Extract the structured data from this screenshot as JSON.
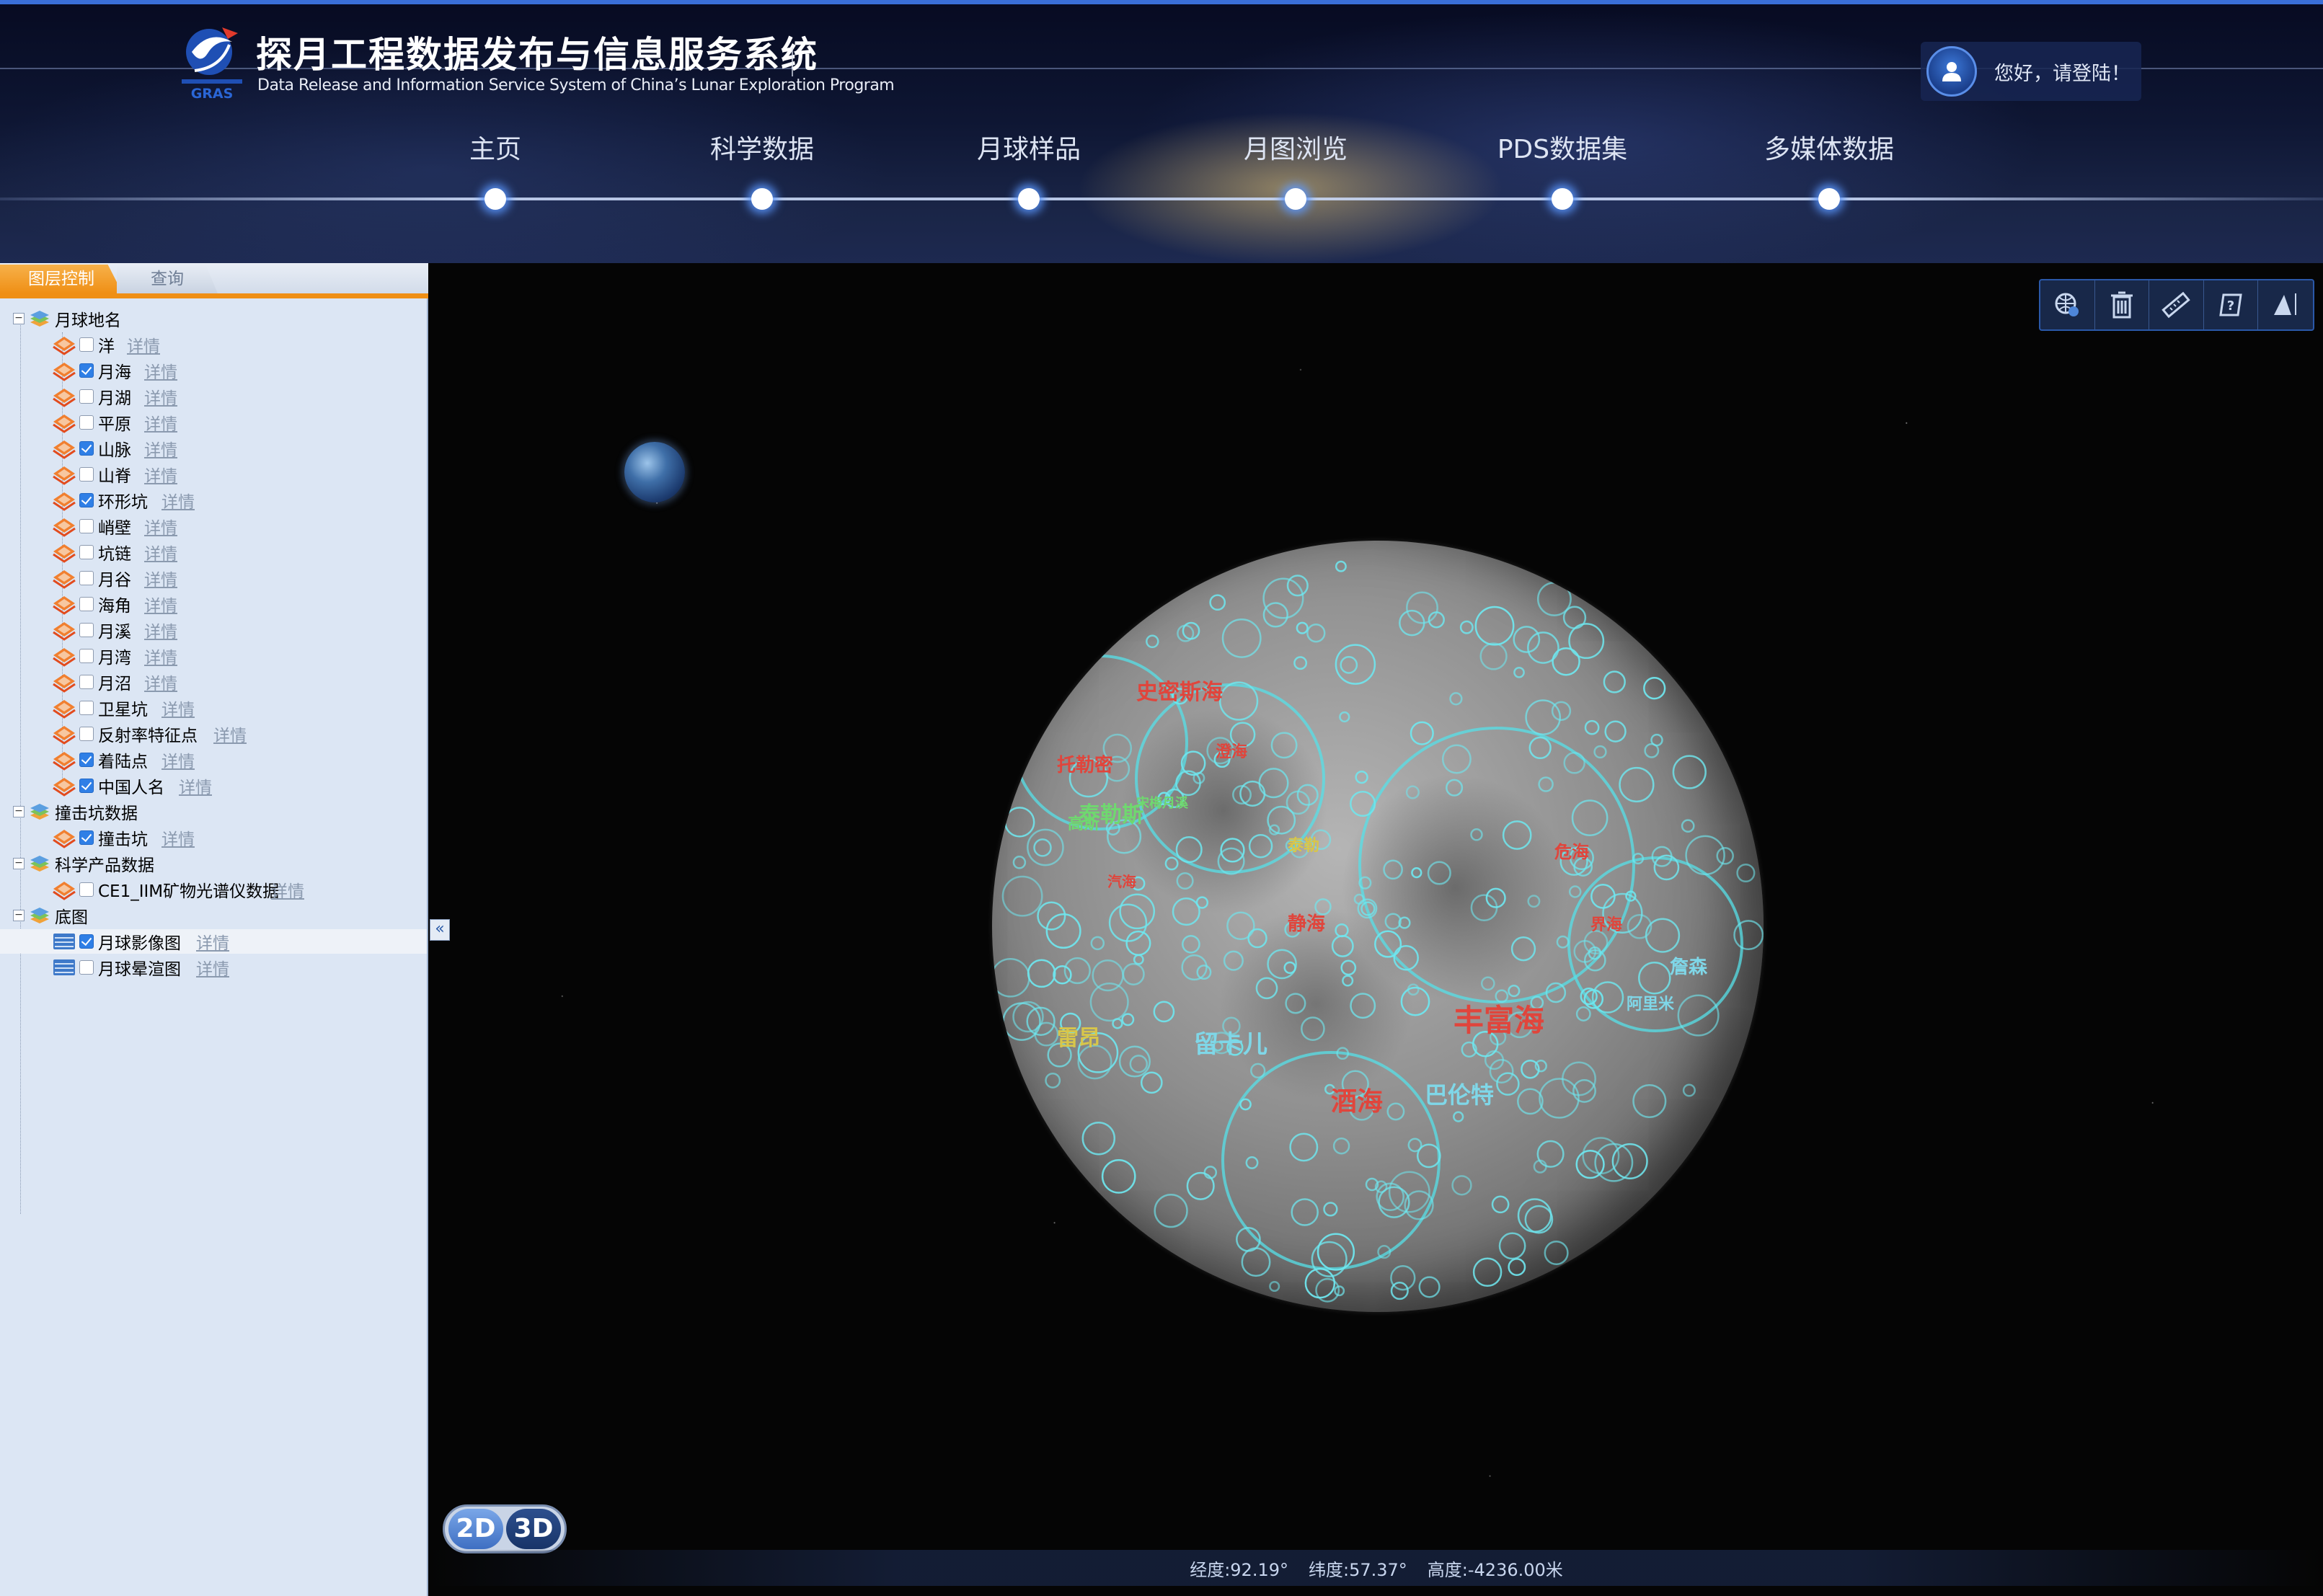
{
  "header": {
    "title_cn": "探月工程数据发布与信息服务系统",
    "title_en": "Data Release and Information Service System of China’s Lunar Exploration Program",
    "logo_text": "GRAS",
    "login_text": "您好，请登陆！"
  },
  "nav": [
    {
      "label": "主页"
    },
    {
      "label": "科学数据"
    },
    {
      "label": "月球样品"
    },
    {
      "label": "月图浏览"
    },
    {
      "label": "PDS数据集"
    },
    {
      "label": "多媒体数据"
    }
  ],
  "nav_active": "月图浏览",
  "tabs": {
    "layer": "图层控制",
    "query": "查询"
  },
  "tree": {
    "groups": [
      {
        "label": "月球地名",
        "expand": "−"
      },
      {
        "label": "撞击坑数据",
        "expand": "−"
      },
      {
        "label": "科学产品数据",
        "expand": "−"
      },
      {
        "label": "底图",
        "expand": "−"
      }
    ],
    "items": [
      {
        "label": "洋",
        "checked": false,
        "detail": "详情"
      },
      {
        "label": "月海",
        "checked": true,
        "detail": "详情"
      },
      {
        "label": "月湖",
        "checked": false,
        "detail": "详情"
      },
      {
        "label": "平原",
        "checked": false,
        "detail": "详情"
      },
      {
        "label": "山脉",
        "checked": true,
        "detail": "详情"
      },
      {
        "label": "山脊",
        "checked": false,
        "detail": "详情"
      },
      {
        "label": "环形坑",
        "checked": true,
        "detail": "详情"
      },
      {
        "label": "峭壁",
        "checked": false,
        "detail": "详情"
      },
      {
        "label": "坑链",
        "checked": false,
        "detail": "详情"
      },
      {
        "label": "月谷",
        "checked": false,
        "detail": "详情"
      },
      {
        "label": "海角",
        "checked": false,
        "detail": "详情"
      },
      {
        "label": "月溪",
        "checked": false,
        "detail": "详情"
      },
      {
        "label": "月湾",
        "checked": false,
        "detail": "详情"
      },
      {
        "label": "月沼",
        "checked": false,
        "detail": "详情"
      },
      {
        "label": "卫星坑",
        "checked": false,
        "detail": "详情"
      },
      {
        "label": "反射率特征点",
        "checked": false,
        "detail": "详情"
      },
      {
        "label": "着陆点",
        "checked": true,
        "detail": "详情"
      },
      {
        "label": "中国人名",
        "checked": true,
        "detail": "详情"
      },
      {
        "label": "撞击坑",
        "checked": true,
        "detail": "详情"
      },
      {
        "label": "CE1_IIM矿物光谱仪数据",
        "checked": false,
        "detail": "详情"
      },
      {
        "label": "月球影像图",
        "checked": true,
        "detail": "详情"
      },
      {
        "label": "月球晕渲图",
        "checked": false,
        "detail": "详情"
      }
    ]
  },
  "map": {
    "collapse_glyph": "«",
    "toolbar": [
      {
        "name": "layers-globe-icon"
      },
      {
        "name": "trash-icon"
      },
      {
        "name": "ruler-icon"
      },
      {
        "name": "help-icon"
      },
      {
        "name": "terrain-icon"
      }
    ],
    "switch": {
      "d2": "2D",
      "d3": "3D"
    },
    "status": {
      "lon": "经度:92.19°",
      "lat": "纬度:57.37°",
      "alt": "高度:-4236.00米"
    },
    "moon_labels": [
      {
        "text": "丰富海",
        "color": "#e0453c"
      },
      {
        "text": "酒海",
        "color": "#e0453c"
      },
      {
        "text": "静海",
        "color": "#e0453c"
      },
      {
        "text": "危海",
        "color": "#e0453c"
      },
      {
        "text": "界海",
        "color": "#e0453c"
      },
      {
        "text": "汽海",
        "color": "#e0453c"
      },
      {
        "text": "澄海",
        "color": "#e0453c"
      },
      {
        "text": "史密斯海",
        "color": "#e0453c"
      },
      {
        "text": "托勒密",
        "color": "#e0453c"
      },
      {
        "text": "泰勒斯",
        "color": "#6fd86f"
      },
      {
        "text": "高斯",
        "color": "#6fd86f"
      },
      {
        "text": "宋梅月溪",
        "color": "#6fd86f"
      },
      {
        "text": "泰勒",
        "color": "#d8c64a"
      },
      {
        "text": "雷昂",
        "color": "#d8c64a"
      },
      {
        "text": "留卡儿",
        "color": "#7fd7e8"
      },
      {
        "text": "巴伦特",
        "color": "#7fd7e8"
      },
      {
        "text": "詹森",
        "color": "#7fd7e8"
      },
      {
        "text": "阿里米",
        "color": "#7fd7e8"
      }
    ]
  }
}
